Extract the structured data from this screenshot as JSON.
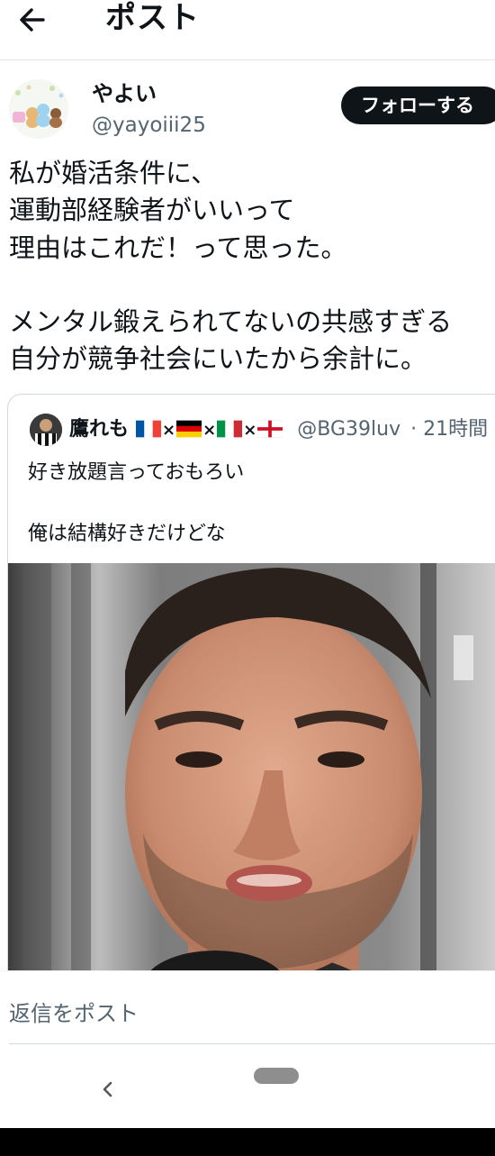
{
  "header": {
    "title": "ポスト",
    "back_icon": "arrow-left-icon"
  },
  "author": {
    "name": "やよい",
    "handle": "@yayoiii25",
    "follow_label": "フォローする"
  },
  "post": {
    "text": "私が婚活条件に、\n運動部経験者がいいって\n理由はこれだ！って思った。\n\nメンタル鍛えられてないの共感すぎる\n自分が競争社会にいたから余計に。"
  },
  "quote": {
    "name": "鷹れも",
    "separator": "×",
    "flags": [
      "france-flag",
      "germany-flag",
      "italy-flag",
      "england-flag"
    ],
    "handle": "@BG39luv",
    "time": "· 21時間",
    "text": "好き放題言っておもろい\n\n俺は結構好きだけどな",
    "media_icon": "video-thumbnail"
  },
  "reply": {
    "placeholder": "返信をポスト"
  },
  "nav": {
    "back_icon": "chevron-left-icon",
    "home_icon": "home-pill-icon"
  },
  "colors": {
    "text": "#0f1419",
    "muted": "#536471",
    "border": "#cfd9de",
    "button_bg": "#0f1419"
  }
}
